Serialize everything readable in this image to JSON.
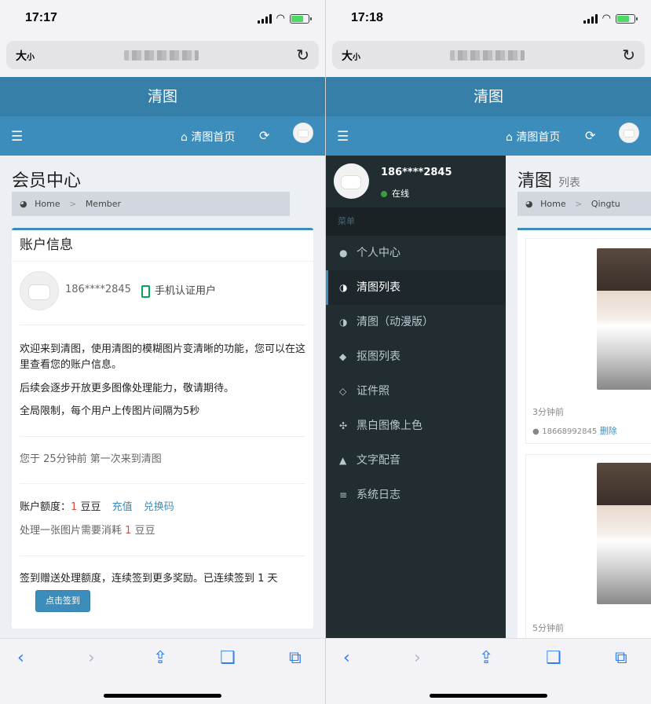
{
  "left": {
    "status_time": "17:17",
    "url_aa": "大",
    "url_aa_small": "小",
    "app_title": "清图",
    "nav_home": "清图首页",
    "page_title": "会员中心",
    "breadcrumb": {
      "home": "Home",
      "sep": ">",
      "current": "Member"
    },
    "box_title": "账户信息",
    "phone": "186****2845",
    "verified_label": "手机认证用户",
    "intro_1": "欢迎来到清图，使用清图的模糊图片变清晰的功能，您可以在这里查看您的账户信息。",
    "intro_2": "后续会逐步开放更多图像处理能力，敬请期待。",
    "intro_3": "全局限制，每个用户上传图片间隔为5秒",
    "first_visit": "您于 25分钟前 第一次来到清图",
    "quota_label": "账户额度：",
    "quota_value": "1",
    "quota_unit": "豆豆",
    "recharge": "充值",
    "redeem": "兑换码",
    "cost_prefix": "处理一张图片需要消耗",
    "cost_value": "1",
    "cost_unit": "豆豆",
    "checkin_text": "签到赠送处理额度，连续签到更多奖励。已连续签到 1 天",
    "checkin_button": "点击签到"
  },
  "right": {
    "status_time": "17:18",
    "url_aa": "大",
    "url_aa_small": "小",
    "app_title": "清图",
    "nav_home": "清图首页",
    "sidebar": {
      "username": "186****2845",
      "online": "在线",
      "header": "菜单",
      "items": [
        {
          "label": "个人中心",
          "icon": "user-icon"
        },
        {
          "label": "清图列表",
          "icon": "half-circle-icon"
        },
        {
          "label": "清图（动漫版）",
          "icon": "half-circle-icon"
        },
        {
          "label": "抠图列表",
          "icon": "tags-icon"
        },
        {
          "label": "证件照",
          "icon": "diamond-icon"
        },
        {
          "label": "黑白图像上色",
          "icon": "pinwheel-icon"
        },
        {
          "label": "文字配音",
          "icon": "android-icon"
        },
        {
          "label": "系统日志",
          "icon": "list-icon"
        }
      ]
    },
    "page_title": "清图",
    "page_subtitle": "列表",
    "breadcrumb": {
      "home": "Home",
      "sep": ">",
      "current": "Qingtu"
    },
    "cards": [
      {
        "time": "3分钟前",
        "user": "18668992845",
        "action": "删除"
      },
      {
        "time": "5分钟前"
      }
    ]
  },
  "colors": {
    "header_dark": "#367fa9",
    "header": "#3c8dbc",
    "sidebar": "#222d32",
    "accent_red": "#dd4b39"
  }
}
